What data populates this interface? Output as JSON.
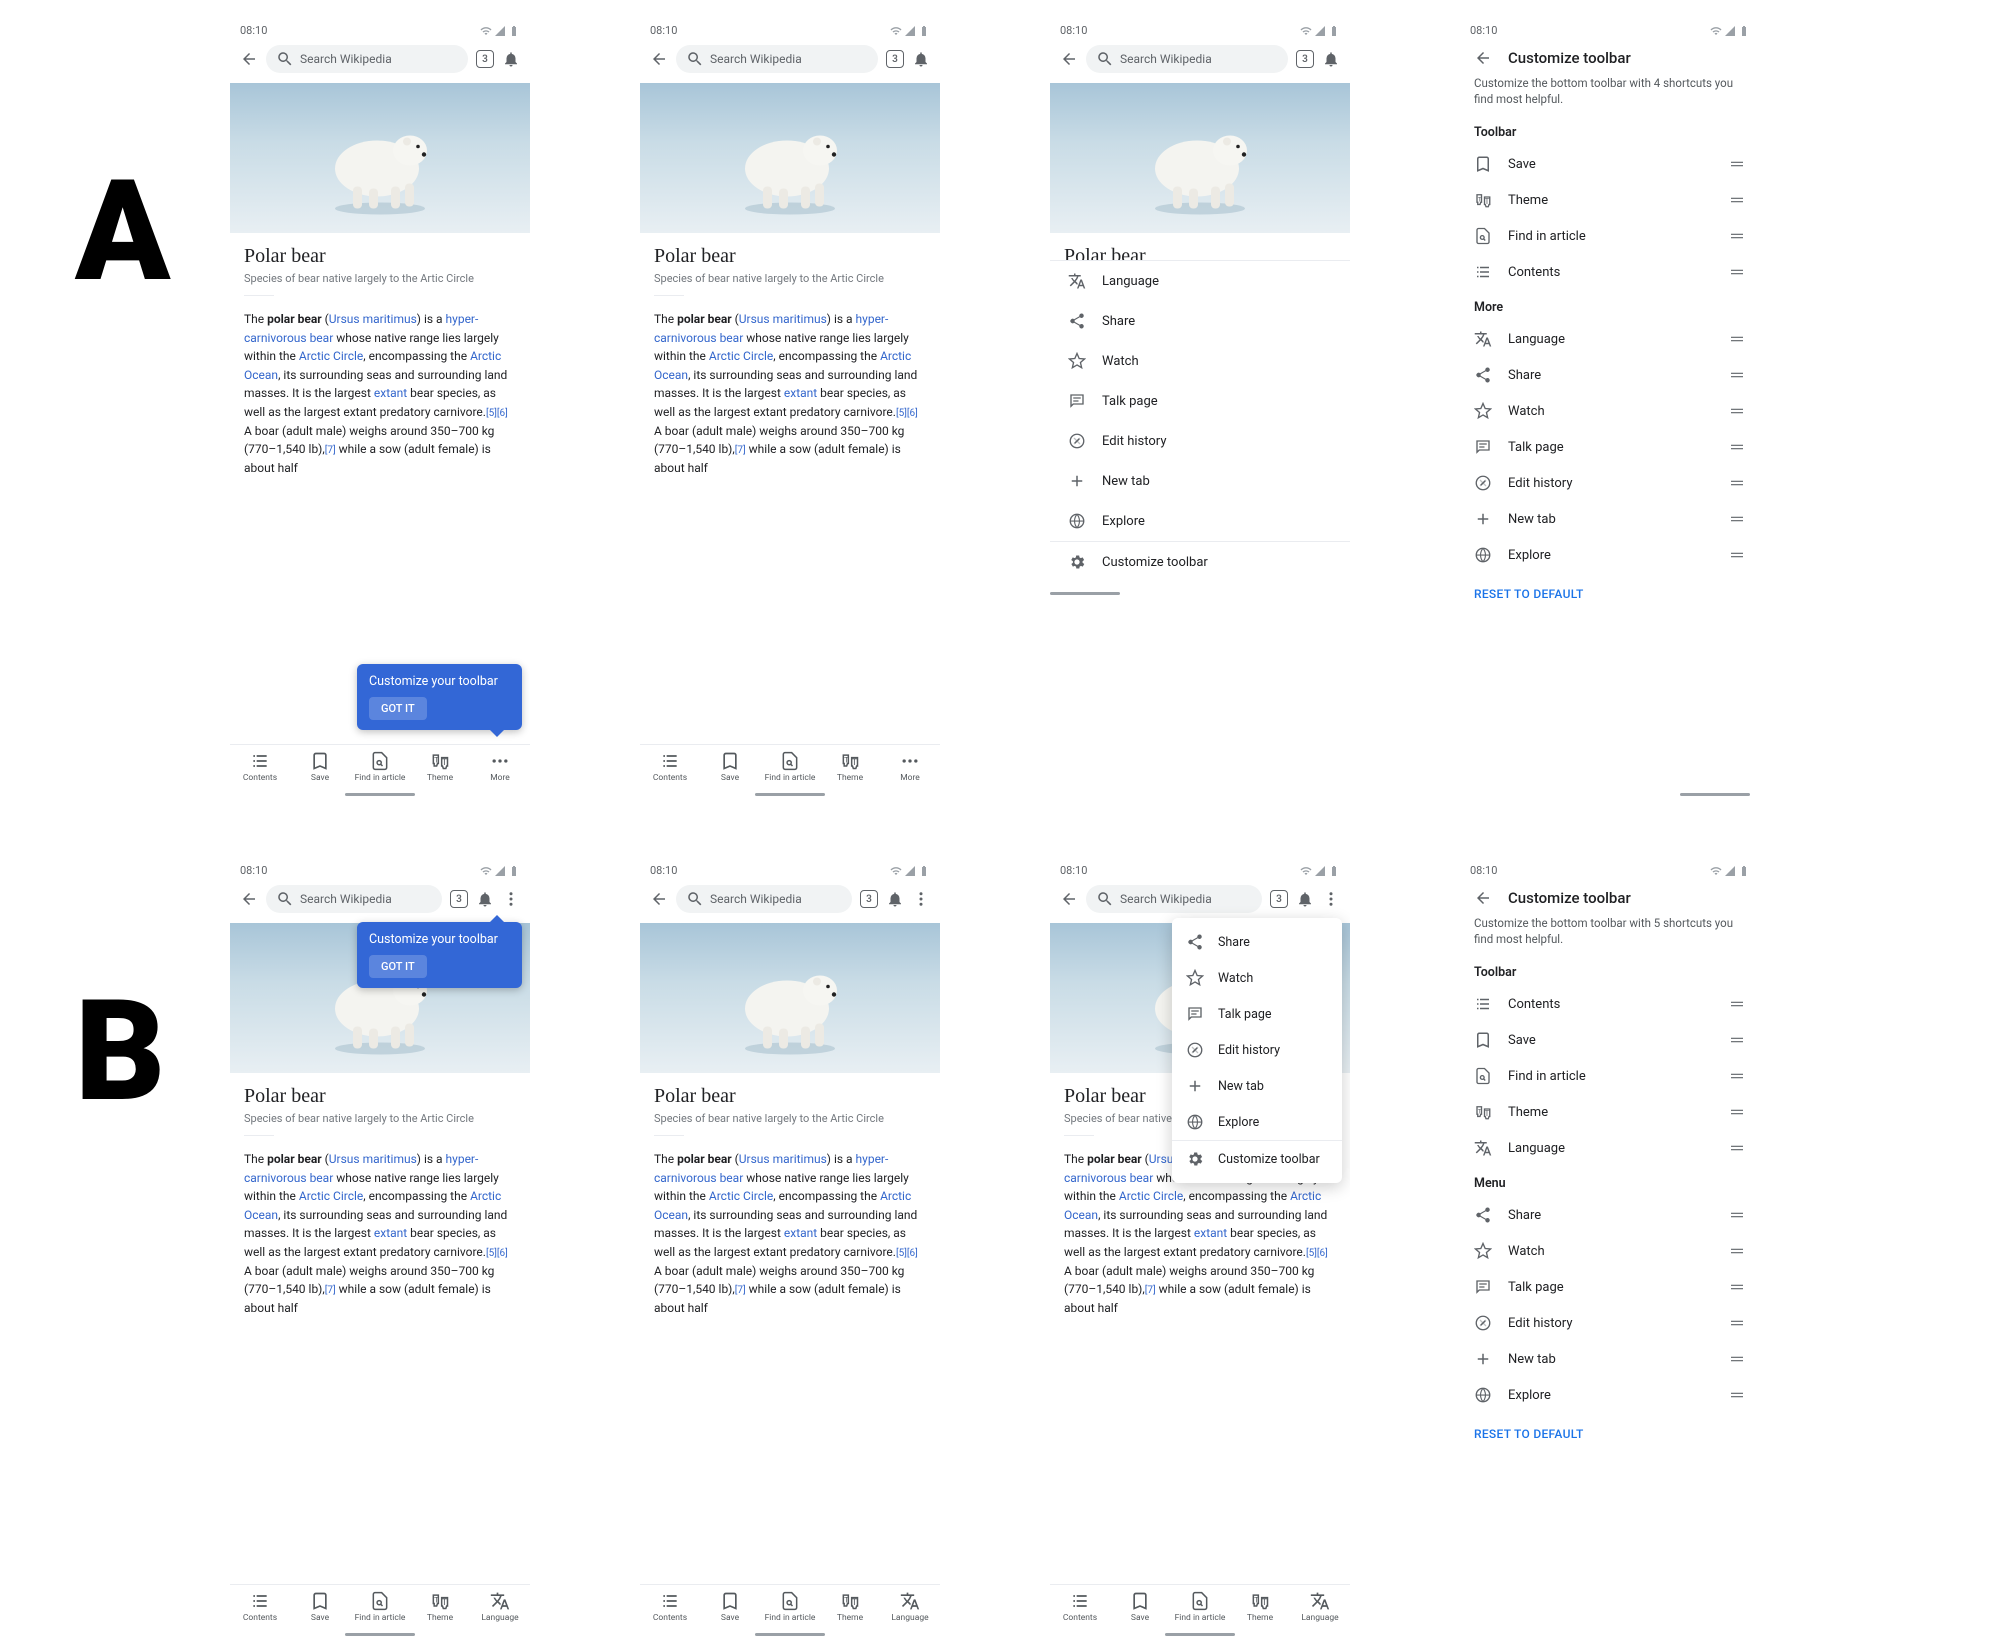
{
  "labels": {
    "A": "A",
    "B": "B"
  },
  "status": {
    "time": "08:10"
  },
  "topbar": {
    "search_placeholder": "Search Wikipedia",
    "tab_count": "3"
  },
  "article": {
    "title": "Polar bear",
    "subtitle": "Species of bear native largely to the Artic Circle",
    "p_the": "The ",
    "p_polarbear": "polar bear",
    "p_open": " (",
    "p_ursus": "Ursus maritimus",
    "p_close_isa": ") is a ",
    "p_hyper": "hyper-carnivorous bear",
    "p_seg1": " whose native range lies largely within the ",
    "p_arctic_circle": "Arctic Circle",
    "p_seg2": ", encompassing the ",
    "p_arctic_ocean": "Arctic Ocean",
    "p_seg3": ", its surrounding seas and surrounding land masses. It is the largest ",
    "p_extant": "extant",
    "p_seg4": " bear species, as well as the largest extant predatory carnivore.",
    "p_ref56": "[5][6]",
    "p_seg5": " A boar (adult male) weighs around 350–700 kg (770–1,540 lb),",
    "p_ref7": "[7]",
    "p_seg6": " while a sow (adult female) is about half"
  },
  "bottombar_A": {
    "contents": "Contents",
    "save": "Save",
    "find": "Find in article",
    "theme": "Theme",
    "more": "More"
  },
  "bottombar_B": {
    "contents": "Contents",
    "save": "Save",
    "find": "Find in article",
    "theme": "Theme",
    "language": "Language"
  },
  "callout": {
    "title": "Customize your toolbar",
    "button": "GOT IT"
  },
  "sheet_A3": {
    "language": "Language",
    "share": "Share",
    "watch": "Watch",
    "talk": "Talk page",
    "edit": "Edit history",
    "newtab": "New tab",
    "explore": "Explore",
    "customize": "Customize toolbar"
  },
  "popup_B3": {
    "share": "Share",
    "watch": "Watch",
    "talk": "Talk page",
    "edit": "Edit history",
    "newtab": "New tab",
    "explore": "Explore",
    "customize": "Customize toolbar"
  },
  "settings": {
    "title": "Customize toolbar",
    "desc_A": "Customize the bottom toolbar with 4 shortcuts you find most helpful.",
    "desc_B": "Customize the bottom toolbar with 5 shortcuts you find most helpful.",
    "toolbar_h": "Toolbar",
    "more_h": "More",
    "menu_h": "Menu",
    "reset": "RESET TO DEFAULT",
    "items": {
      "save": "Save",
      "theme": "Theme",
      "find": "Find in article",
      "contents": "Contents",
      "language": "Language",
      "share": "Share",
      "watch": "Watch",
      "talk": "Talk page",
      "edit": "Edit history",
      "newtab": "New tab",
      "explore": "Explore"
    }
  }
}
